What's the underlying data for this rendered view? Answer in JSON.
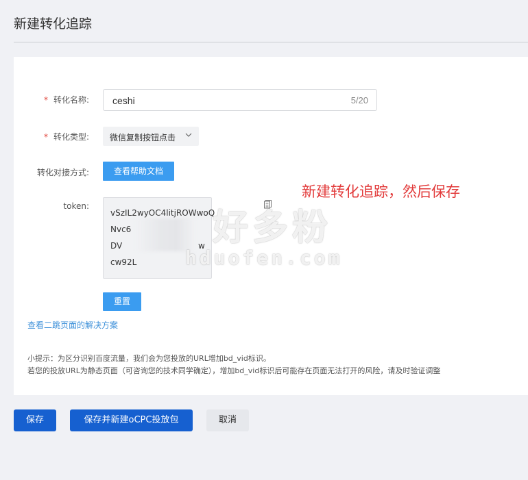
{
  "page": {
    "title": "新建转化追踪"
  },
  "form": {
    "name": {
      "required_mark": "*",
      "label": "转化名称:",
      "value": "ceshi",
      "counter": "5/20"
    },
    "type": {
      "required_mark": "*",
      "label": "转化类型:",
      "value": "微信复制按钮点击"
    },
    "integration": {
      "label": "转化对接方式:",
      "button_label": "查看帮助文档"
    },
    "token": {
      "label": "token:",
      "lines": [
        "vSzIL2wyOC4litjROWwoQ",
        "Nvc6",
        "DV",
        "cw92L"
      ],
      "partial_tail": "w"
    },
    "reset_label": "重置"
  },
  "links": {
    "redirect_solution": "查看二跳页面的解决方案"
  },
  "tips": {
    "line1": "小提示：为区分识别百度流量，我们会为您投放的URL增加bd_vid标识。",
    "line2": "若您的投放URL为静态页面（可咨询您的技术同学确定），增加bd_vid标识后可能存在页面无法打开的风险，请及时验证调整"
  },
  "annotation": "新建转化追踪，然后保存",
  "watermark": {
    "cn": "好多粉",
    "en": "hduofen.com"
  },
  "footer": {
    "save": "保存",
    "save_and_new": "保存并新建oCPC投放包",
    "cancel": "取消"
  },
  "colors": {
    "primary": "#1660d0",
    "light_primary": "#3b9cf0",
    "required": "#e0463c",
    "annotation": "#e23b3b",
    "link": "#3b8fd9"
  },
  "icons": {
    "select_arrow": "chevron-down-icon",
    "copy": "copy-icon"
  }
}
